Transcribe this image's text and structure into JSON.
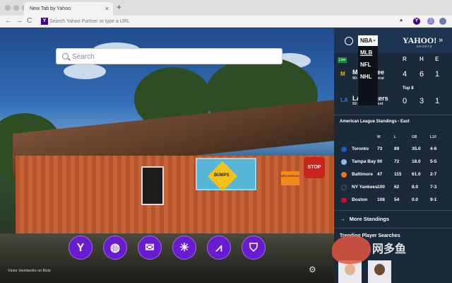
{
  "browser": {
    "tab_title": "New Tab by Yahoo",
    "tab_close": "×",
    "new_tab": "+",
    "back": "←",
    "forward": "→",
    "reload": "C",
    "omnibox_logo": "Y",
    "omnibox_placeholder": "Search Yahoo Partner or type a URL",
    "star": "★",
    "ext_y": "Y",
    "ext_shield": "▯"
  },
  "search": {
    "placeholder": "Search"
  },
  "apps": [
    {
      "icon": "yahoo-icon",
      "glyph": "Y"
    },
    {
      "icon": "basketball-icon",
      "glyph": "◍"
    },
    {
      "icon": "mail-icon",
      "glyph": "✉"
    },
    {
      "icon": "weather-icon",
      "glyph": "☀"
    },
    {
      "icon": "finance-icon",
      "glyph": "⩘"
    },
    {
      "icon": "shopping-bag-icon",
      "glyph": "⛉"
    }
  ],
  "photo": {
    "credit": "Victor Hemberllo on flickr",
    "sign_bumps": "BUMPS",
    "sign_stop": "STOP",
    "sign_men": "MEN WORKING"
  },
  "settings_glyph": "⚙",
  "sports": {
    "league_selected": "NBA",
    "league_options": [
      "MLB",
      "NFL",
      "NHL"
    ],
    "brand": "YAHOO!",
    "brand_sub": "SPORTS",
    "expand": "»",
    "score_headers": [
      "R",
      "H",
      "E"
    ],
    "live_badge": "Live",
    "inning": "Top 8",
    "games": [
      {
        "team": "Milwaukee",
        "record": "90-72, NL Central",
        "r": "4",
        "h": "6",
        "e": "1"
      },
      {
        "team": "LA Dodgers",
        "record": "92-71, 1 NL West",
        "r": "0",
        "h": "3",
        "e": "1"
      }
    ],
    "standings_title": "American League Standings - East",
    "standings_cols": [
      "W",
      "L",
      "GB",
      "L10"
    ],
    "standings": [
      {
        "team": "Toronto",
        "w": "73",
        "l": "89",
        "gb": "35.0",
        "l10": "4-6",
        "color": "#1a5bbf"
      },
      {
        "team": "Tampa Bay",
        "w": "90",
        "l": "72",
        "gb": "18.0",
        "l10": "5-5",
        "color": "#8fbce6"
      },
      {
        "team": "Baltimore",
        "w": "47",
        "l": "115",
        "gb": "61.0",
        "l10": "2-7",
        "color": "#e87722"
      },
      {
        "team": "NY Yankees",
        "w": "100",
        "l": "62",
        "gb": "8.0",
        "l10": "7-3",
        "color": "#1b2a3a"
      },
      {
        "team": "Boston",
        "w": "108",
        "l": "54",
        "gb": "0.0",
        "l10": "9-1",
        "color": "#c8102e"
      }
    ],
    "more_standings": "More Standings",
    "trending": "Trending Player Searches"
  }
}
